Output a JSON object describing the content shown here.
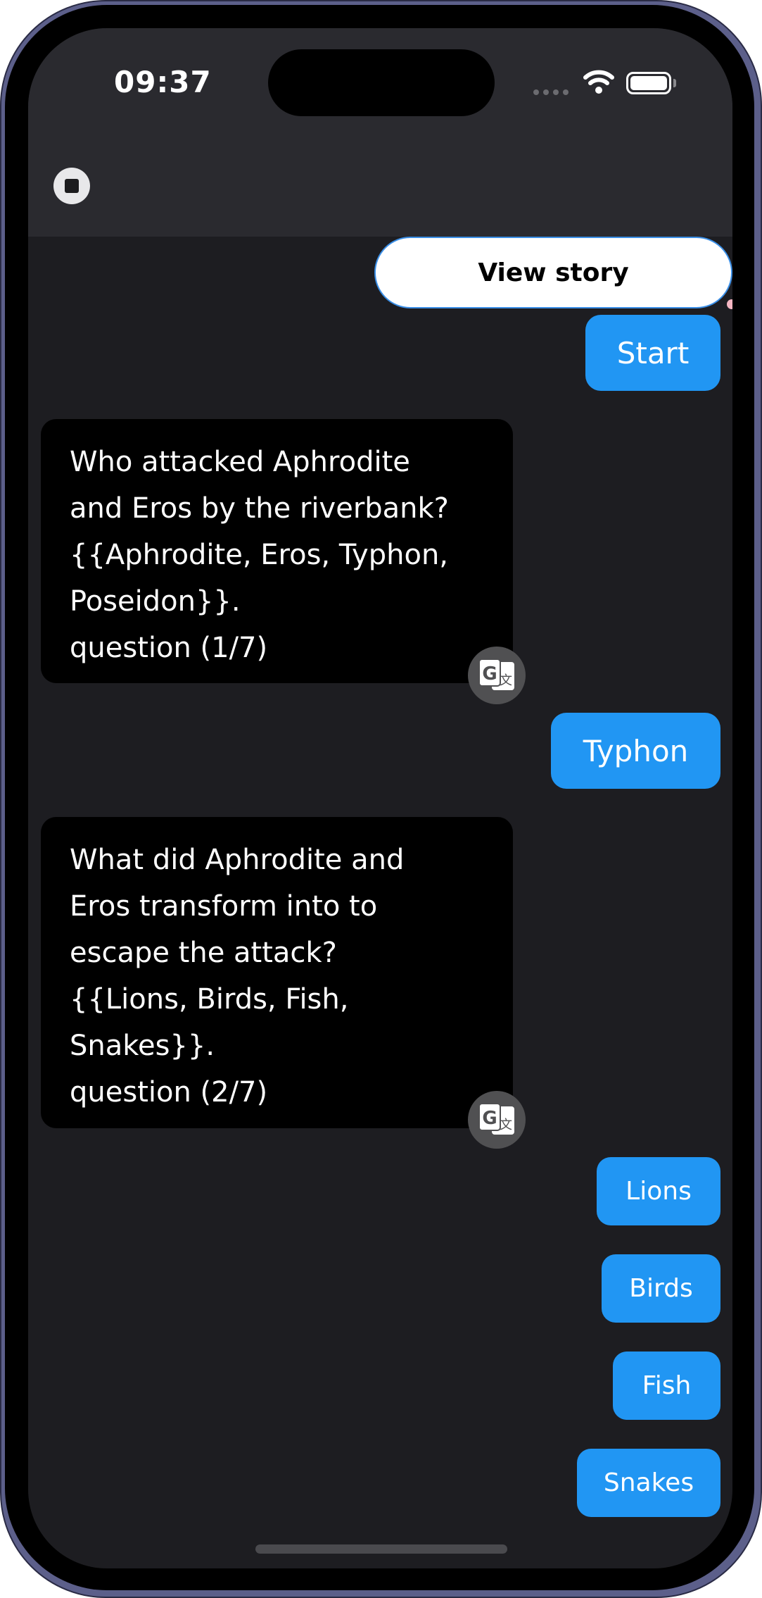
{
  "status_bar": {
    "time": "09:37"
  },
  "header": {
    "stop_icon": "stop-icon"
  },
  "view_story_label": "View story",
  "messages": [
    {
      "role": "user",
      "text": "Start"
    },
    {
      "role": "bot",
      "lines": [
        "Who attacked Aphrodite",
        "and Eros by the riverbank?",
        "{{Aphrodite, Eros, Typhon,",
        "Poseidon}}.",
        "question (1/7)"
      ],
      "translate_icon": "translate-icon"
    },
    {
      "role": "user",
      "text": "Typhon"
    },
    {
      "role": "bot",
      "lines": [
        "What did Aphrodite and",
        "Eros transform into to",
        "escape the attack?",
        "{{Lions, Birds, Fish,",
        "Snakes}}.",
        "question (2/7)"
      ],
      "translate_icon": "translate-icon"
    }
  ],
  "options": [
    "Lions",
    "Birds",
    "Fish",
    "Snakes"
  ],
  "colors": {
    "accent": "#2196f3",
    "background": "#1d1d21",
    "header": "#2a2a2f",
    "bot_bubble": "#000000"
  }
}
